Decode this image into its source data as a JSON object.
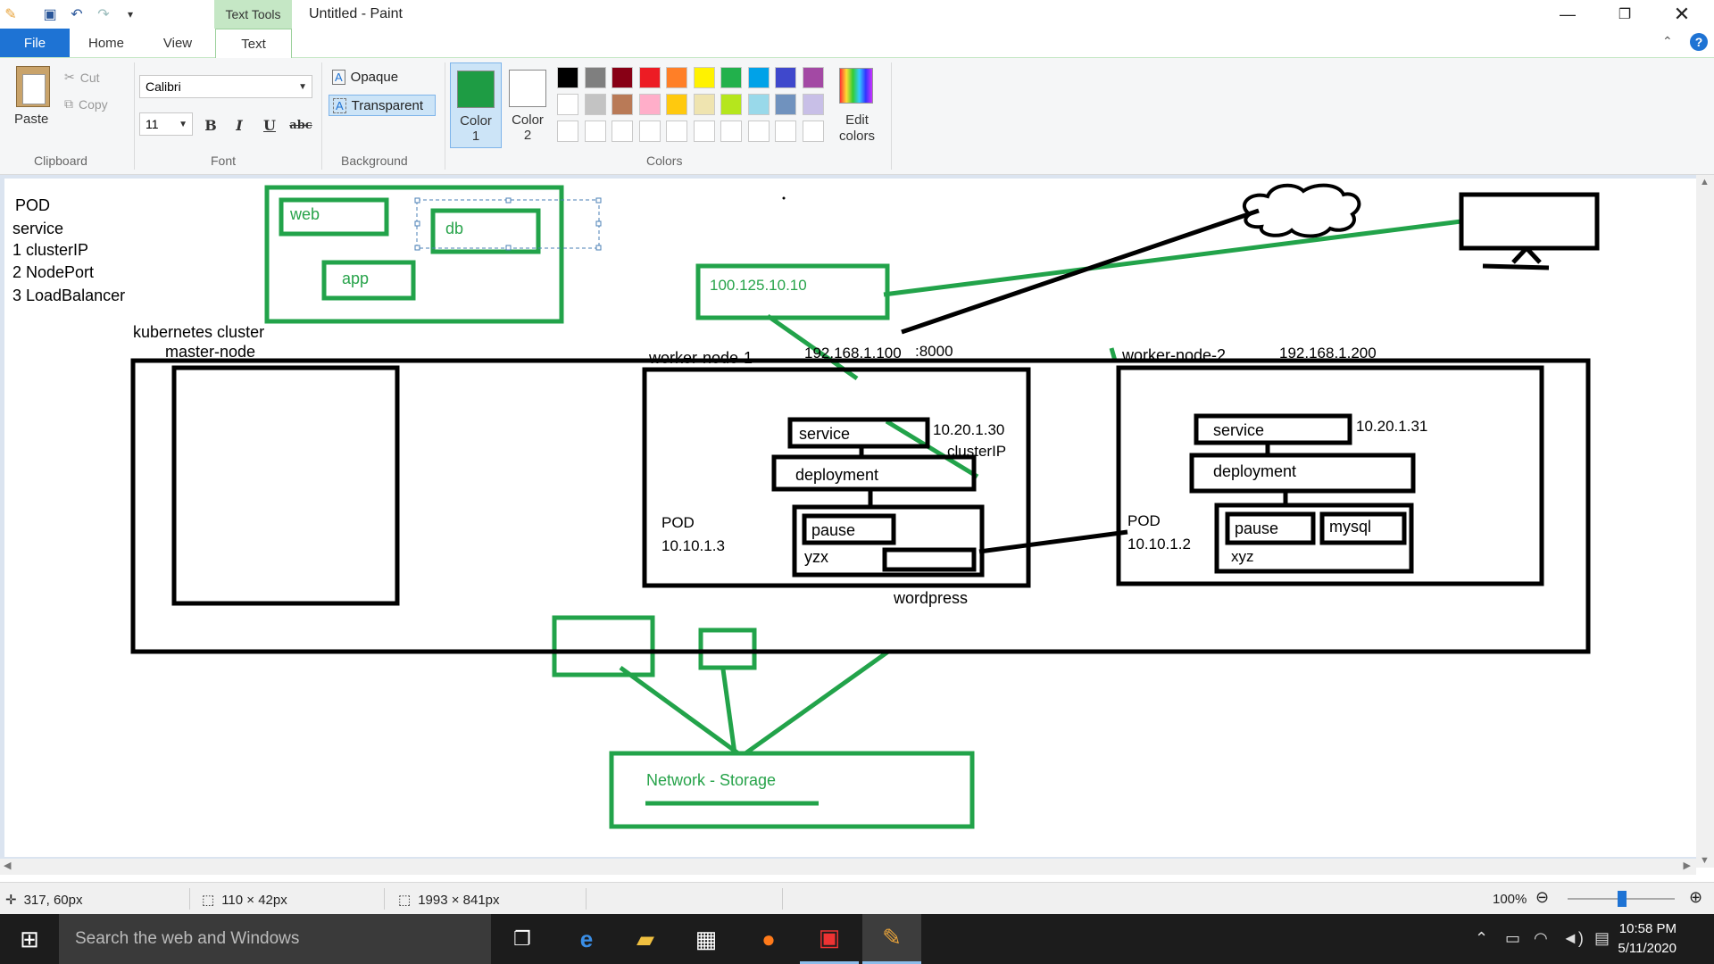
{
  "window": {
    "title": "Untitled - Paint",
    "context_tab": "Text Tools"
  },
  "ribbon_tabs": [
    "File",
    "Home",
    "View",
    "Text"
  ],
  "clipboard": {
    "paste_label": "Paste",
    "cut_label": "Cut",
    "copy_label": "Copy",
    "group_label": "Clipboard"
  },
  "font": {
    "family": "Calibri",
    "size": "11",
    "bold": "B",
    "italic": "I",
    "underline": "U",
    "strike": "abc",
    "group_label": "Font"
  },
  "background": {
    "opaque_label": "Opaque",
    "transparent_label": "Transparent",
    "group_label": "Background",
    "selected": "Transparent"
  },
  "colors": {
    "color1_label": "Color",
    "color1_num": "1",
    "color2_label": "Color",
    "color2_num": "2",
    "color1_value": "#1e9c44",
    "color2_value": "#ffffff",
    "edit_label": "Edit",
    "edit_label2": "colors",
    "group_label": "Colors",
    "palette_row1": [
      "#000000",
      "#7f7f7f",
      "#880015",
      "#ed1c24",
      "#ff7f27",
      "#fff200",
      "#22b14c",
      "#00a2e8",
      "#3f48cc",
      "#a349a4"
    ],
    "palette_row2": [
      "#ffffff",
      "#c3c3c3",
      "#b97a57",
      "#ffaec9",
      "#ffc90e",
      "#efe4b0",
      "#b5e61d",
      "#99d9ea",
      "#7092be",
      "#c8bfe7"
    ]
  },
  "canvas": {
    "legend": {
      "pod": "POD",
      "service": "service",
      "item1": "1  clusterIP",
      "item2": "2 NodePort",
      "item3": "3 LoadBalancer"
    },
    "pod_top": {
      "web": "web",
      "db": "db",
      "app": "app"
    },
    "cluster_label": "kubernetes cluster",
    "master_node": "master-node",
    "worker1": {
      "label": "worker-node-1",
      "ip": "192.168.1.100",
      "port": ":8000",
      "service": "service",
      "service_ip": "10.20.1.30",
      "service_type": "clusterIP",
      "deployment": "deployment",
      "pod_label": "POD",
      "pod_ip": "10.10.1.3",
      "pause": "pause",
      "container": "yzx"
    },
    "worker2": {
      "label": "worker-node-2",
      "ip": "192.168.1.200",
      "service": "service",
      "service_ip": "10.20.1.31",
      "deployment": "deployment",
      "pod_label": "POD",
      "pod_ip": "10.10.1.2",
      "pause": "pause",
      "mysql": "mysql",
      "container": "xyz"
    },
    "public_ip": "100.125.10.10",
    "wordpress": "wordpress",
    "storage": "Network - Storage"
  },
  "statusbar": {
    "cursor": "317, 60px",
    "selection": "110 × 42px",
    "size": "1993 × 841px",
    "zoom": "100%"
  },
  "taskbar": {
    "search_placeholder": "Search the web and Windows",
    "time": "10:58 PM",
    "date": "5/11/2020"
  }
}
